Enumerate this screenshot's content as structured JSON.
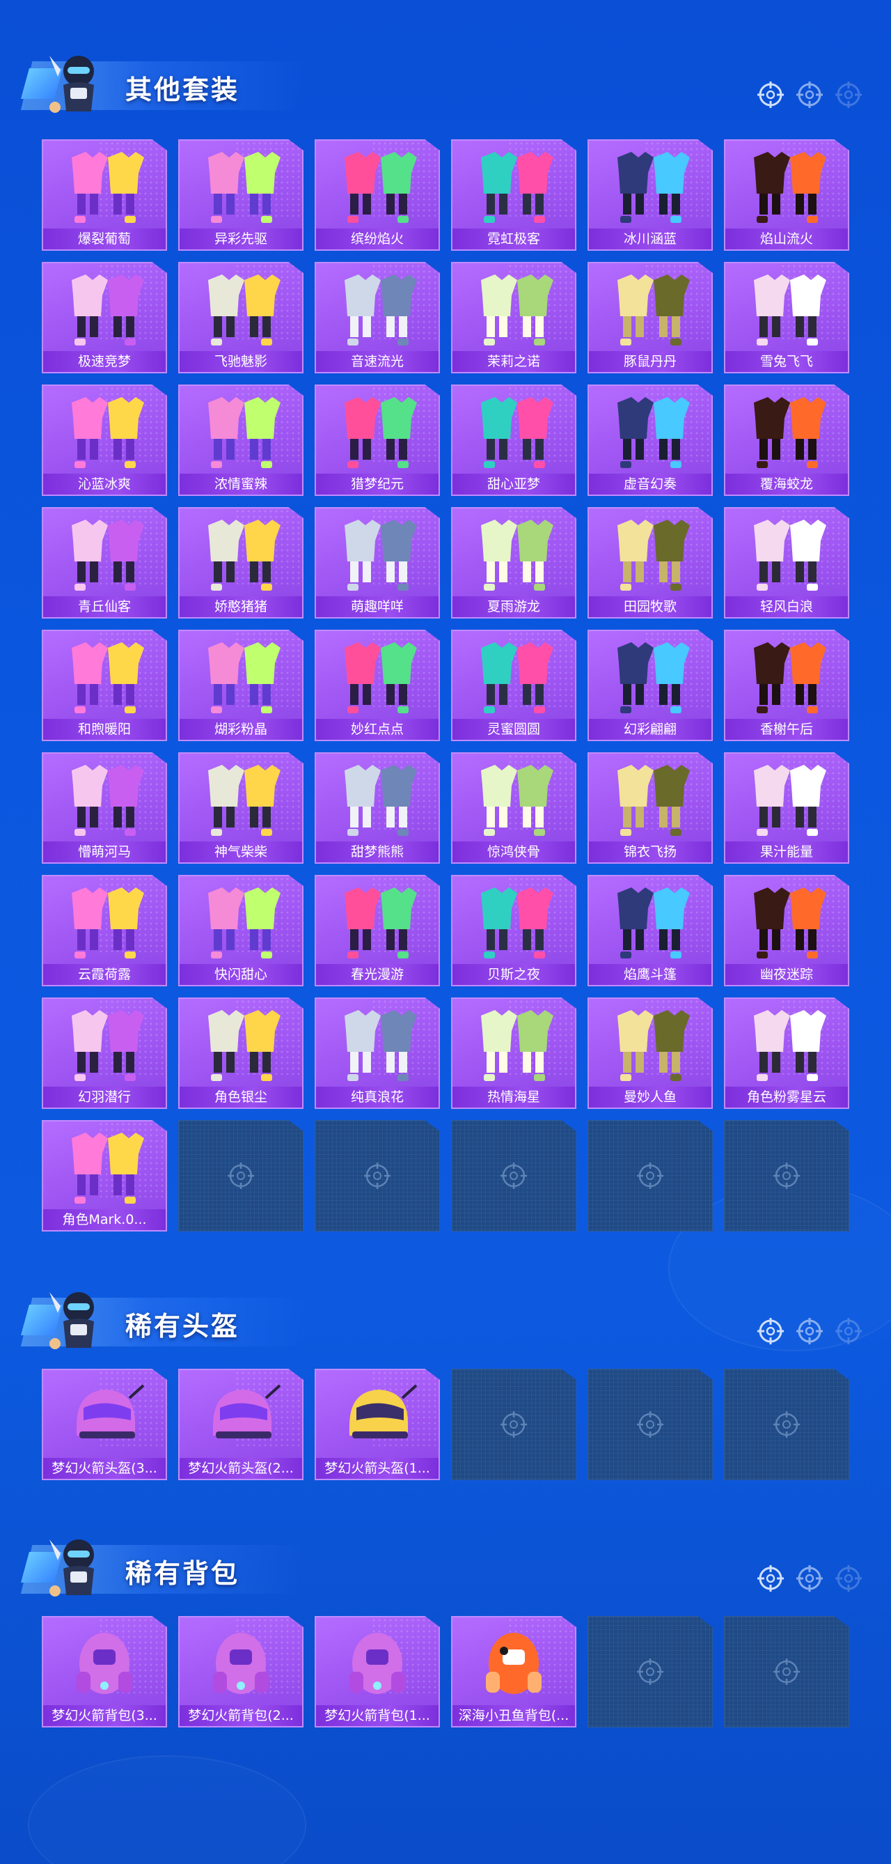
{
  "sections": [
    {
      "id": "outfits",
      "title": "其他套装",
      "items": [
        "爆裂葡萄",
        "异彩先驱",
        "缤纷焰火",
        "霓虹极客",
        "冰川涵蓝",
        "焰山流火",
        "极速竞梦",
        "飞驰魅影",
        "音速流光",
        "茉莉之诺",
        "豚鼠丹丹",
        "雪兔飞飞",
        "沁蓝冰爽",
        "浓情蜜辣",
        "猎梦纪元",
        "甜心亚梦",
        "虚音幻奏",
        "覆海蛟龙",
        "青丘仙客",
        "娇憨猪猪",
        "萌趣咩咩",
        "夏雨游龙",
        "田园牧歌",
        "轻风白浪",
        "和煦暖阳",
        "煳彩粉晶",
        "妙红点点",
        "灵蜜圆圆",
        "幻彩翩翩",
        "香榭午后",
        "懵萌河马",
        "神气柴柴",
        "甜梦熊熊",
        "惊鸿侠骨",
        "锦衣飞扬",
        "果汁能量",
        "云霞荷露",
        "快闪甜心",
        "春光漫游",
        "贝斯之夜",
        "焰鹰斗篷",
        "幽夜迷踪",
        "幻羽潜行",
        "角色银尘",
        "纯真浪花",
        "热情海星",
        "曼妙人鱼",
        "角色粉雾星云",
        "角色Mark.0..."
      ],
      "empty_slots": 5
    },
    {
      "id": "helmets",
      "title": "稀有头盔",
      "items": [
        "梦幻火箭头盔(3...",
        "梦幻火箭头盔(2...",
        "梦幻火箭头盔(1..."
      ],
      "empty_slots": 3
    },
    {
      "id": "backpacks",
      "title": "稀有背包",
      "items": [
        "梦幻火箭背包(3...",
        "梦幻火箭背包(2...",
        "梦幻火箭背包(1...",
        "深海小丑鱼背包(..."
      ],
      "empty_slots": 2
    }
  ],
  "colors": {
    "card_purple": "#a95ef8",
    "label_purple": "#8a3fe8",
    "empty_slot": "#1f4a86",
    "background_blue": "#0b55dc"
  }
}
